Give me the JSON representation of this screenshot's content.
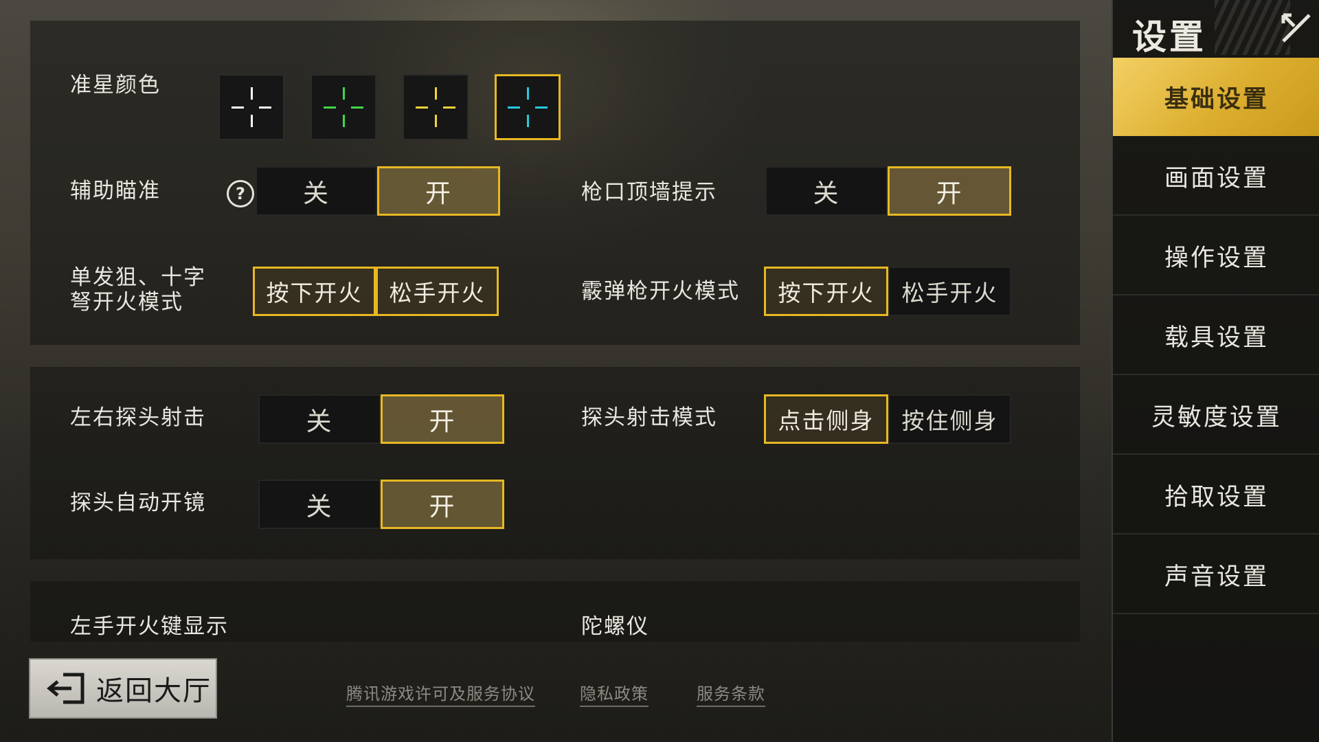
{
  "settings": {
    "crosshair_color": {
      "label": "准星颜色",
      "options": [
        {
          "color": "#ffffff",
          "selected": false
        },
        {
          "color": "#3fd84a",
          "selected": false
        },
        {
          "color": "#f3d33a",
          "selected": false
        },
        {
          "color": "#27c9e0",
          "selected": true
        }
      ]
    },
    "aim_assist": {
      "label": "辅助瞄准",
      "off": "关",
      "on": "开",
      "value": "on"
    },
    "muzzle_wall_hint": {
      "label": "枪口顶墙提示",
      "off": "关",
      "on": "开",
      "value": "on"
    },
    "sniper_fire_mode": {
      "label": "单发狙、十字弩开火模式",
      "press": "按下开火",
      "release": "松手开火",
      "value": "both_highlighted"
    },
    "shotgun_fire_mode": {
      "label": "霰弹枪开火模式",
      "press": "按下开火",
      "release": "松手开火",
      "value": "press"
    },
    "peek_fire": {
      "label": "左右探头射击",
      "off": "关",
      "on": "开",
      "value": "on"
    },
    "peek_mode": {
      "label": "探头射击模式",
      "tap": "点击侧身",
      "hold": "按住侧身",
      "value": "tap"
    },
    "peek_auto_scope": {
      "label": "探头自动开镜",
      "off": "关",
      "on": "开",
      "value": "on"
    },
    "left_fire_button": {
      "label": "左手开火键显示"
    },
    "gyroscope": {
      "label": "陀螺仪"
    }
  },
  "sidebar": {
    "title": "设置",
    "items": [
      {
        "label": "基础设置",
        "active": true
      },
      {
        "label": "画面设置",
        "active": false
      },
      {
        "label": "操作设置",
        "active": false
      },
      {
        "label": "载具设置",
        "active": false
      },
      {
        "label": "灵敏度设置",
        "active": false
      },
      {
        "label": "拾取设置",
        "active": false
      },
      {
        "label": "声音设置",
        "active": false
      }
    ]
  },
  "footer": {
    "back_label": "返回大厅",
    "links": [
      "腾讯游戏许可及服务协议",
      "隐私政策",
      "服务条款"
    ]
  },
  "icons": {
    "help": "?",
    "close": "close-icon",
    "back": "exit-door-icon"
  },
  "colors": {
    "accent": "#e8b823",
    "active_tab": "#dcae2f"
  }
}
